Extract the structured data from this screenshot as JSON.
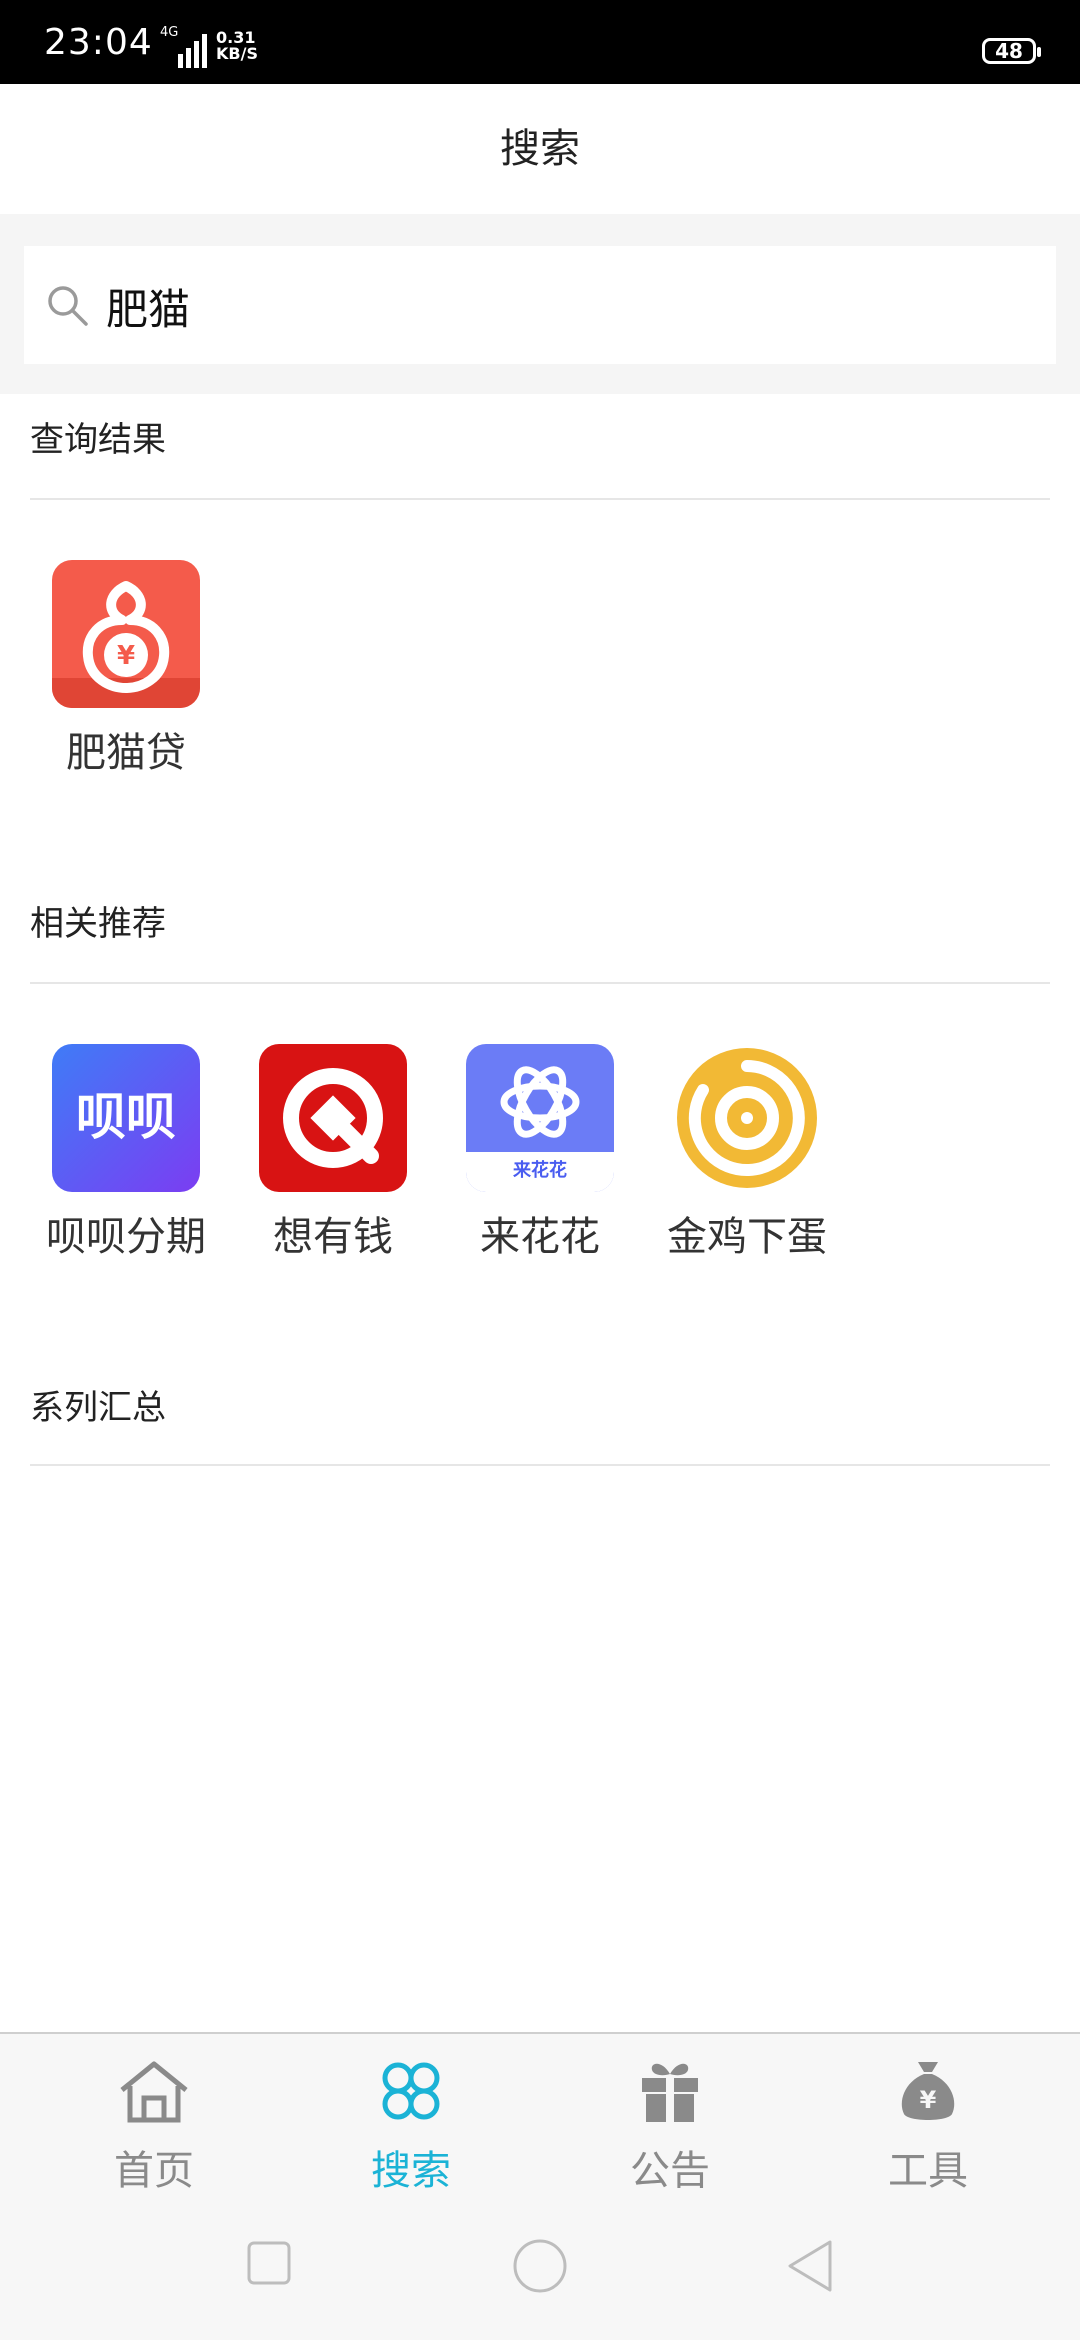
{
  "status_bar": {
    "time": "23:04",
    "network": "4G",
    "speed_value": "0.31",
    "speed_unit": "KB/S",
    "battery": "48"
  },
  "header": {
    "title": "搜索"
  },
  "search": {
    "value": "肥猫",
    "placeholder": ""
  },
  "sections": {
    "results": {
      "title": "查询结果",
      "items": [
        {
          "label": "肥猫贷",
          "icon": "fat-cat-loan-app-icon"
        }
      ]
    },
    "recommend": {
      "title": "相关推荐",
      "items": [
        {
          "label": "呗呗分期",
          "icon": "beibei-app-icon"
        },
        {
          "label": "想有钱",
          "icon": "xiangyouqian-app-icon"
        },
        {
          "label": "来花花",
          "icon": "laihuahua-app-icon",
          "icon_text": "来花花"
        },
        {
          "label": "金鸡下蛋",
          "icon": "jinjixiadan-app-icon"
        }
      ]
    },
    "series": {
      "title": "系列汇总"
    }
  },
  "bottom_nav": {
    "active_index": 1,
    "items": [
      {
        "label": "首页",
        "icon": "home-icon"
      },
      {
        "label": "搜索",
        "icon": "clover-search-icon"
      },
      {
        "label": "公告",
        "icon": "gift-icon"
      },
      {
        "label": "工具",
        "icon": "money-bag-icon"
      }
    ]
  },
  "colors": {
    "accent": "#1bb3d6",
    "nav_inactive": "#8a8a8a",
    "fatcat_red": "#f45b4b",
    "beibei_blue": "#5a5cf6",
    "xiangyouqian_red": "#d81313",
    "laihuahua_blue": "#6b7cf6",
    "jinji_yellow": "#f2b935"
  }
}
